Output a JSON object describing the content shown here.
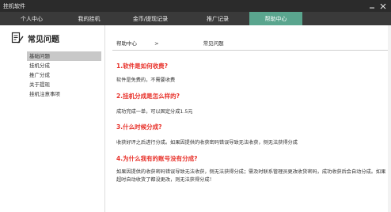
{
  "app": {
    "title": "挂机软件"
  },
  "nav": {
    "tabs": [
      {
        "label": "个人中心"
      },
      {
        "label": "我的挂机"
      },
      {
        "label": "金币/提现记录"
      },
      {
        "label": "推广记录"
      },
      {
        "label": "帮助中心"
      }
    ],
    "active_index": 4
  },
  "sidebar": {
    "title": "常见问题",
    "icon": "faq-document-icon",
    "items": [
      {
        "label": "基础问题"
      },
      {
        "label": "挂机分成"
      },
      {
        "label": "推广分成"
      },
      {
        "label": "关于提现"
      },
      {
        "label": "挂机注意事项"
      }
    ],
    "selected_index": 0
  },
  "breadcrumb": {
    "root": "帮助中心",
    "separator": ">",
    "current": "常见问题"
  },
  "faq": [
    {
      "question": "1.软件是如何收费?",
      "answer": "软件是免费的，不需要收费"
    },
    {
      "question": "2.挂机分成是怎么样的?",
      "answer": "成功完成一单，可以固定分成1.5元"
    },
    {
      "question": "3.什么时候分成?",
      "answer": "收获好评之后进行分成。如果因提供的收获密码错误导致无法收获，侧无法获得分成"
    },
    {
      "question": "4.为什么我有的账号没有分成?",
      "answer": "如果因提供的收获密码错误导致无法收获，侧无法获得分成；需及时联系管理员更改收货密码，成功收获后会自动分成。如果超时自动收货了都没更改，则无法获得分成！"
    }
  ],
  "colors": {
    "nav_active": "#5aa58e",
    "question": "#e8322b",
    "titlebar": "#2b2b2b",
    "navbar": "#3a3a3a"
  }
}
